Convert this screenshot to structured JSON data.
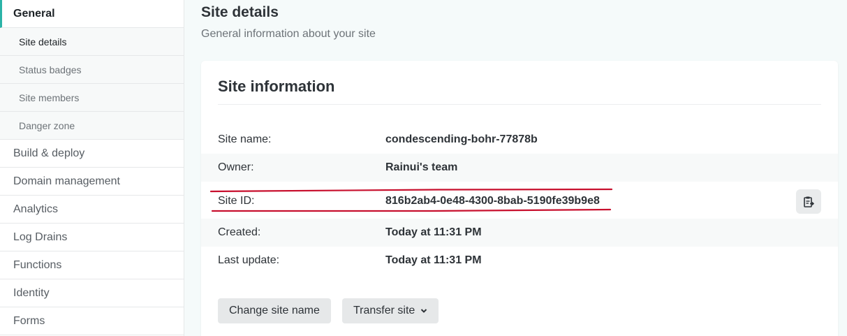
{
  "sidebar": {
    "items": [
      {
        "label": "General"
      },
      {
        "label": "Site details"
      },
      {
        "label": "Status badges"
      },
      {
        "label": "Site members"
      },
      {
        "label": "Danger zone"
      },
      {
        "label": "Build & deploy"
      },
      {
        "label": "Domain management"
      },
      {
        "label": "Analytics"
      },
      {
        "label": "Log Drains"
      },
      {
        "label": "Functions"
      },
      {
        "label": "Identity"
      },
      {
        "label": "Forms"
      }
    ]
  },
  "header": {
    "title": "Site details",
    "subtitle": "General information about your site"
  },
  "card": {
    "title": "Site information",
    "rows": [
      {
        "label": "Site name:",
        "value": "condescending-bohr-77878b"
      },
      {
        "label": "Owner:",
        "value": "Rainui's team"
      },
      {
        "label": "Site ID:",
        "value": "816b2ab4-0e48-4300-8bab-5190fe39b9e8"
      },
      {
        "label": "Created:",
        "value": "Today at 11:31 PM"
      },
      {
        "label": "Last update:",
        "value": "Today at 11:31 PM"
      }
    ],
    "buttons": {
      "change_name": "Change site name",
      "transfer": "Transfer site"
    }
  },
  "icons": {
    "copy": "clipboard-icon",
    "dropdown": "chevron-down-icon"
  },
  "colors": {
    "accent": "#2bb3a7",
    "annotation": "#c8102e"
  }
}
